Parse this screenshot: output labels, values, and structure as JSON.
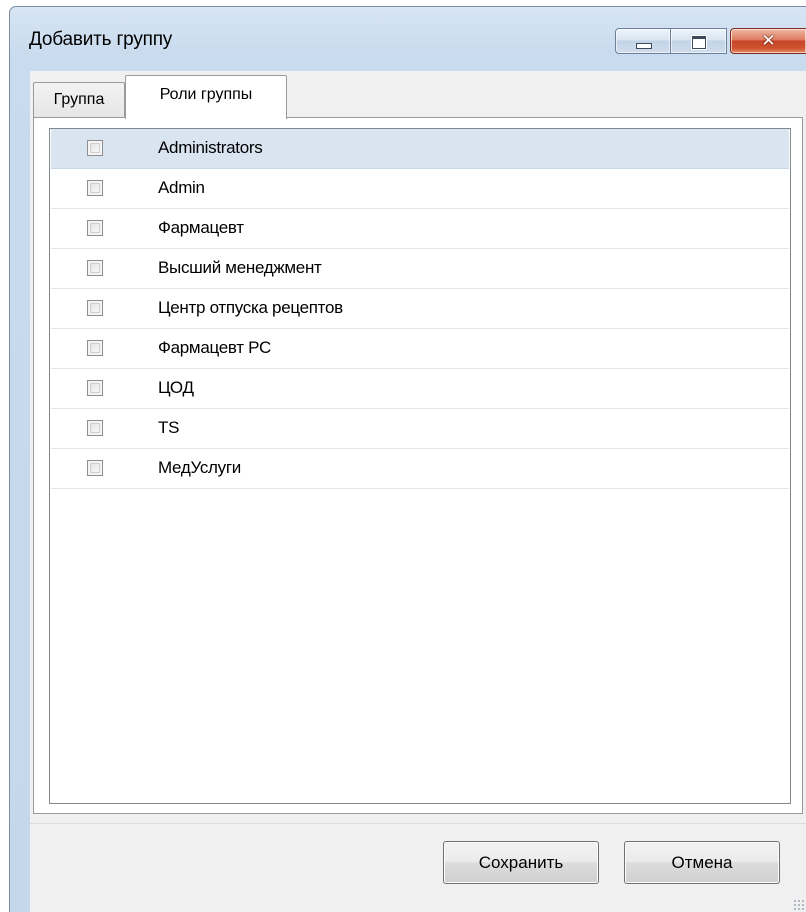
{
  "window": {
    "title": "Добавить группу"
  },
  "titlebar": {
    "minimize_icon": "minimize-icon",
    "maximize_icon": "maximize-icon",
    "close_icon": "close-icon",
    "close_glyph": "✕"
  },
  "tabs": [
    {
      "label": "Группа",
      "active": false
    },
    {
      "label": "Роли группы",
      "active": true
    }
  ],
  "roles": {
    "items": [
      {
        "label": "Administrators",
        "checked": false,
        "selected": true
      },
      {
        "label": "Admin",
        "checked": false,
        "selected": false
      },
      {
        "label": "Фармацевт",
        "checked": false,
        "selected": false
      },
      {
        "label": "Высший менеджмент",
        "checked": false,
        "selected": false
      },
      {
        "label": "Центр отпуска рецептов",
        "checked": false,
        "selected": false
      },
      {
        "label": "Фармацевт РС",
        "checked": false,
        "selected": false
      },
      {
        "label": "ЦОД",
        "checked": false,
        "selected": false
      },
      {
        "label": "TS",
        "checked": false,
        "selected": false
      },
      {
        "label": "МедУслуги",
        "checked": false,
        "selected": false
      }
    ]
  },
  "footer": {
    "save_label": "Сохранить",
    "cancel_label": "Отмена"
  },
  "colors": {
    "selection": "#d9e4f1",
    "frame": "#c9dbee",
    "close_button": "#c7452a"
  }
}
